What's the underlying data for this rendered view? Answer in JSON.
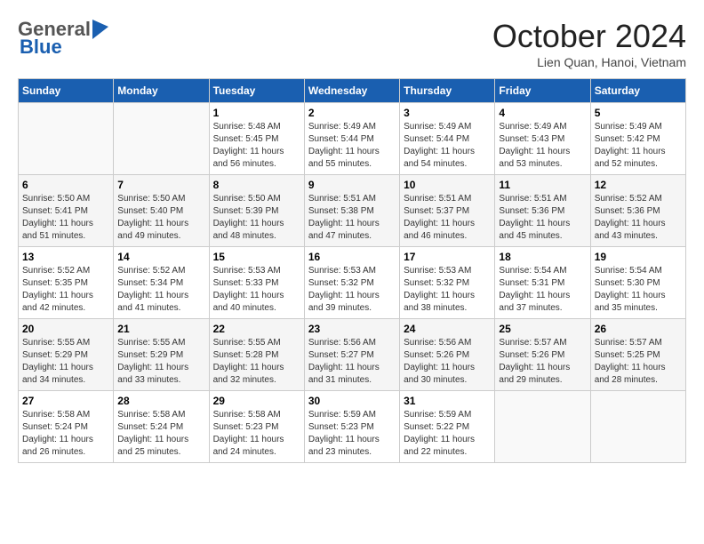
{
  "header": {
    "logo_general": "General",
    "logo_blue": "Blue",
    "month_title": "October 2024",
    "subtitle": "Lien Quan, Hanoi, Vietnam"
  },
  "days_of_week": [
    "Sunday",
    "Monday",
    "Tuesday",
    "Wednesday",
    "Thursday",
    "Friday",
    "Saturday"
  ],
  "weeks": [
    [
      {
        "day": "",
        "info": ""
      },
      {
        "day": "",
        "info": ""
      },
      {
        "day": "1",
        "info": "Sunrise: 5:48 AM\nSunset: 5:45 PM\nDaylight: 11 hours and 56 minutes."
      },
      {
        "day": "2",
        "info": "Sunrise: 5:49 AM\nSunset: 5:44 PM\nDaylight: 11 hours and 55 minutes."
      },
      {
        "day": "3",
        "info": "Sunrise: 5:49 AM\nSunset: 5:44 PM\nDaylight: 11 hours and 54 minutes."
      },
      {
        "day": "4",
        "info": "Sunrise: 5:49 AM\nSunset: 5:43 PM\nDaylight: 11 hours and 53 minutes."
      },
      {
        "day": "5",
        "info": "Sunrise: 5:49 AM\nSunset: 5:42 PM\nDaylight: 11 hours and 52 minutes."
      }
    ],
    [
      {
        "day": "6",
        "info": "Sunrise: 5:50 AM\nSunset: 5:41 PM\nDaylight: 11 hours and 51 minutes."
      },
      {
        "day": "7",
        "info": "Sunrise: 5:50 AM\nSunset: 5:40 PM\nDaylight: 11 hours and 49 minutes."
      },
      {
        "day": "8",
        "info": "Sunrise: 5:50 AM\nSunset: 5:39 PM\nDaylight: 11 hours and 48 minutes."
      },
      {
        "day": "9",
        "info": "Sunrise: 5:51 AM\nSunset: 5:38 PM\nDaylight: 11 hours and 47 minutes."
      },
      {
        "day": "10",
        "info": "Sunrise: 5:51 AM\nSunset: 5:37 PM\nDaylight: 11 hours and 46 minutes."
      },
      {
        "day": "11",
        "info": "Sunrise: 5:51 AM\nSunset: 5:36 PM\nDaylight: 11 hours and 45 minutes."
      },
      {
        "day": "12",
        "info": "Sunrise: 5:52 AM\nSunset: 5:36 PM\nDaylight: 11 hours and 43 minutes."
      }
    ],
    [
      {
        "day": "13",
        "info": "Sunrise: 5:52 AM\nSunset: 5:35 PM\nDaylight: 11 hours and 42 minutes."
      },
      {
        "day": "14",
        "info": "Sunrise: 5:52 AM\nSunset: 5:34 PM\nDaylight: 11 hours and 41 minutes."
      },
      {
        "day": "15",
        "info": "Sunrise: 5:53 AM\nSunset: 5:33 PM\nDaylight: 11 hours and 40 minutes."
      },
      {
        "day": "16",
        "info": "Sunrise: 5:53 AM\nSunset: 5:32 PM\nDaylight: 11 hours and 39 minutes."
      },
      {
        "day": "17",
        "info": "Sunrise: 5:53 AM\nSunset: 5:32 PM\nDaylight: 11 hours and 38 minutes."
      },
      {
        "day": "18",
        "info": "Sunrise: 5:54 AM\nSunset: 5:31 PM\nDaylight: 11 hours and 37 minutes."
      },
      {
        "day": "19",
        "info": "Sunrise: 5:54 AM\nSunset: 5:30 PM\nDaylight: 11 hours and 35 minutes."
      }
    ],
    [
      {
        "day": "20",
        "info": "Sunrise: 5:55 AM\nSunset: 5:29 PM\nDaylight: 11 hours and 34 minutes."
      },
      {
        "day": "21",
        "info": "Sunrise: 5:55 AM\nSunset: 5:29 PM\nDaylight: 11 hours and 33 minutes."
      },
      {
        "day": "22",
        "info": "Sunrise: 5:55 AM\nSunset: 5:28 PM\nDaylight: 11 hours and 32 minutes."
      },
      {
        "day": "23",
        "info": "Sunrise: 5:56 AM\nSunset: 5:27 PM\nDaylight: 11 hours and 31 minutes."
      },
      {
        "day": "24",
        "info": "Sunrise: 5:56 AM\nSunset: 5:26 PM\nDaylight: 11 hours and 30 minutes."
      },
      {
        "day": "25",
        "info": "Sunrise: 5:57 AM\nSunset: 5:26 PM\nDaylight: 11 hours and 29 minutes."
      },
      {
        "day": "26",
        "info": "Sunrise: 5:57 AM\nSunset: 5:25 PM\nDaylight: 11 hours and 28 minutes."
      }
    ],
    [
      {
        "day": "27",
        "info": "Sunrise: 5:58 AM\nSunset: 5:24 PM\nDaylight: 11 hours and 26 minutes."
      },
      {
        "day": "28",
        "info": "Sunrise: 5:58 AM\nSunset: 5:24 PM\nDaylight: 11 hours and 25 minutes."
      },
      {
        "day": "29",
        "info": "Sunrise: 5:58 AM\nSunset: 5:23 PM\nDaylight: 11 hours and 24 minutes."
      },
      {
        "day": "30",
        "info": "Sunrise: 5:59 AM\nSunset: 5:23 PM\nDaylight: 11 hours and 23 minutes."
      },
      {
        "day": "31",
        "info": "Sunrise: 5:59 AM\nSunset: 5:22 PM\nDaylight: 11 hours and 22 minutes."
      },
      {
        "day": "",
        "info": ""
      },
      {
        "day": "",
        "info": ""
      }
    ]
  ]
}
